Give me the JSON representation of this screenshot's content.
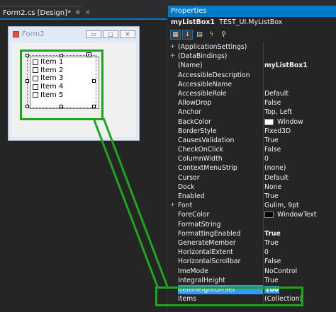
{
  "document_tab": {
    "title": "Form2.cs [Design]*",
    "pin_icon": "pin-icon",
    "close_icon": "close-icon"
  },
  "form": {
    "title": "Form2",
    "listbox_items": [
      "Item 1",
      "Item 2",
      "Item 3",
      "Item 4",
      "Item 5"
    ]
  },
  "properties": {
    "panel_title": "Properties",
    "object_name": "myListBox1",
    "object_type": "TEST_UI.MyListBox",
    "rows": [
      {
        "name": "(ApplicationSettings)",
        "value": "",
        "expand": "+"
      },
      {
        "name": "(DataBindings)",
        "value": "",
        "expand": "+"
      },
      {
        "name": "(Name)",
        "value": "myListBox1",
        "bold": true
      },
      {
        "name": "AccessibleDescription",
        "value": ""
      },
      {
        "name": "AccessibleName",
        "value": ""
      },
      {
        "name": "AccessibleRole",
        "value": "Default"
      },
      {
        "name": "AllowDrop",
        "value": "False"
      },
      {
        "name": "Anchor",
        "value": "Top, Left"
      },
      {
        "name": "BackColor",
        "value": "Window",
        "swatch": "#ffffff"
      },
      {
        "name": "BorderStyle",
        "value": "Fixed3D"
      },
      {
        "name": "CausesValidation",
        "value": "True"
      },
      {
        "name": "CheckOnClick",
        "value": "False"
      },
      {
        "name": "ColumnWidth",
        "value": "0"
      },
      {
        "name": "ContextMenuStrip",
        "value": "(none)"
      },
      {
        "name": "Cursor",
        "value": "Default"
      },
      {
        "name": "Dock",
        "value": "None"
      },
      {
        "name": "Enabled",
        "value": "True"
      },
      {
        "name": "Font",
        "value": "Gulim, 9pt",
        "expand": "+"
      },
      {
        "name": "ForeColor",
        "value": "WindowText",
        "swatch": "#000000"
      },
      {
        "name": "FormatString",
        "value": ""
      },
      {
        "name": "FormattingEnabled",
        "value": "True",
        "bold": true
      },
      {
        "name": "GenerateMember",
        "value": "True"
      },
      {
        "name": "HorizontalExtent",
        "value": "0"
      },
      {
        "name": "HorizontalScrollbar",
        "value": "False"
      },
      {
        "name": "ImeMode",
        "value": "NoControl"
      },
      {
        "name": "IntegralHeight",
        "value": "True"
      },
      {
        "name": "ItemHeightOffSet",
        "value": "100",
        "selected": true
      },
      {
        "name": "Items",
        "value": "(Collection)"
      }
    ]
  },
  "highlight_color": "#1ea51e",
  "accent_color": "#007acc"
}
